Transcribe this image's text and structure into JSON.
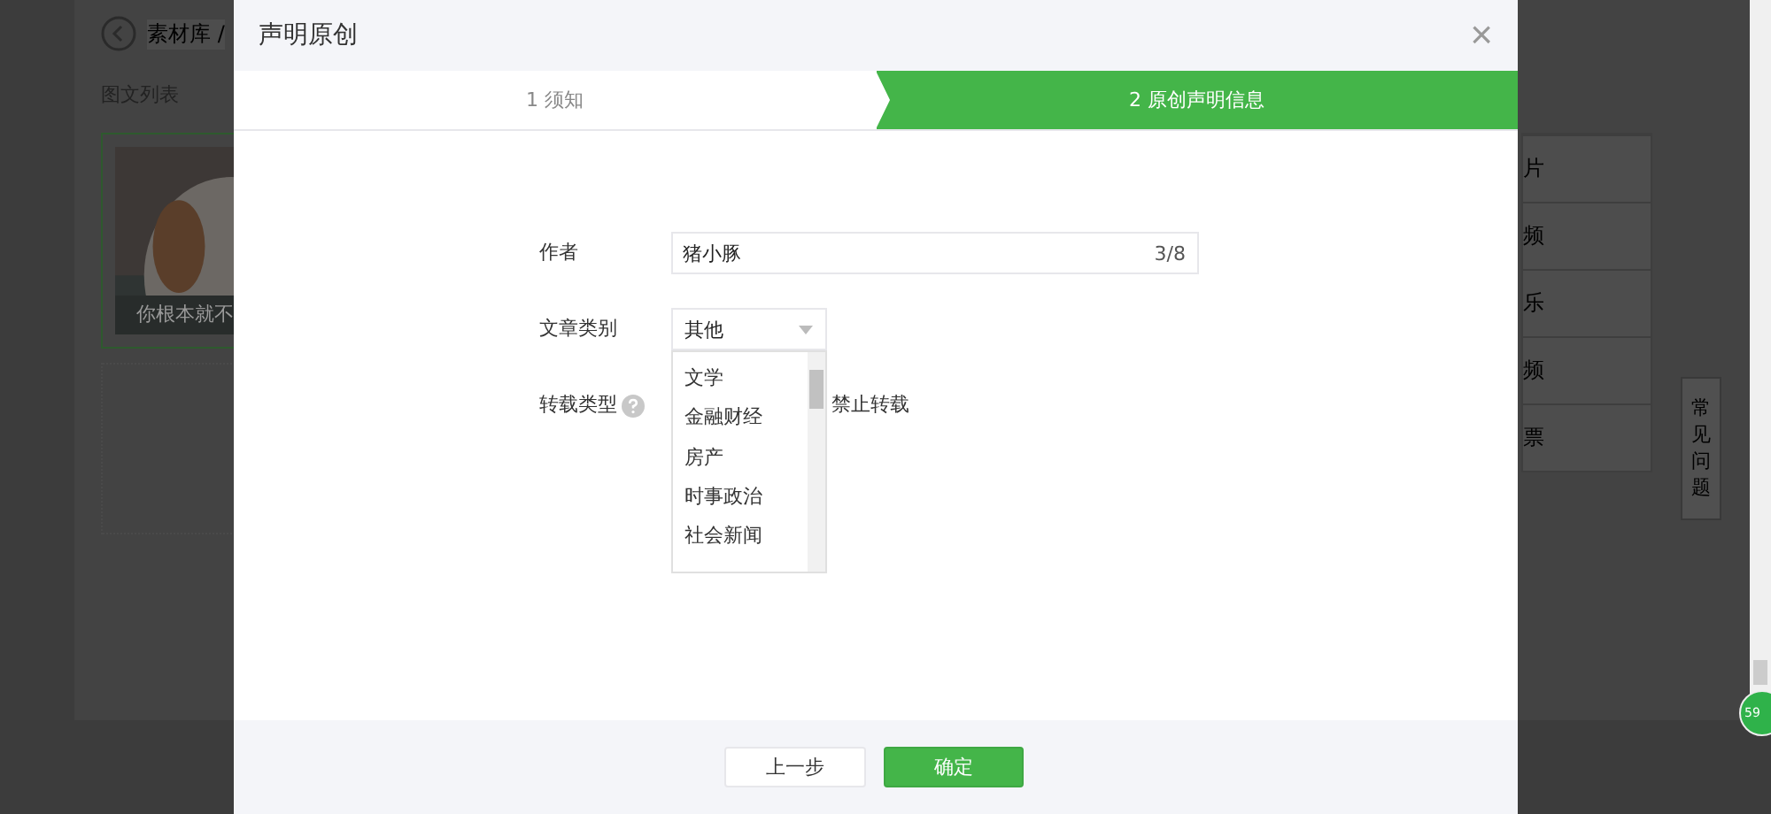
{
  "page": {
    "breadcrumb": "素材库 /",
    "section_title": "图文列表",
    "article_caption": "你根本就不",
    "right_menu": [
      "片",
      "频",
      "乐",
      "频",
      "票"
    ],
    "faq_tab": "常见问题",
    "speed_badge": "59"
  },
  "dialog": {
    "title": "声明原创",
    "close": "×",
    "steps": [
      {
        "label": "1 须知",
        "selected": false
      },
      {
        "label": "2 原创声明信息",
        "selected": true
      }
    ],
    "author": {
      "label": "作者",
      "value": "猪小豚",
      "counter": "3/8"
    },
    "category": {
      "label": "文章类别",
      "value": "其他",
      "expanded": true,
      "options": [
        "文学",
        "金融财经",
        "房产",
        "时事政治",
        "社会新闻"
      ]
    },
    "reprint": {
      "label": "转载类型",
      "option": "禁止转载"
    },
    "buttons": [
      {
        "label": "上一步",
        "kind": "secondary"
      },
      {
        "label": "确定",
        "kind": "primary"
      }
    ]
  }
}
